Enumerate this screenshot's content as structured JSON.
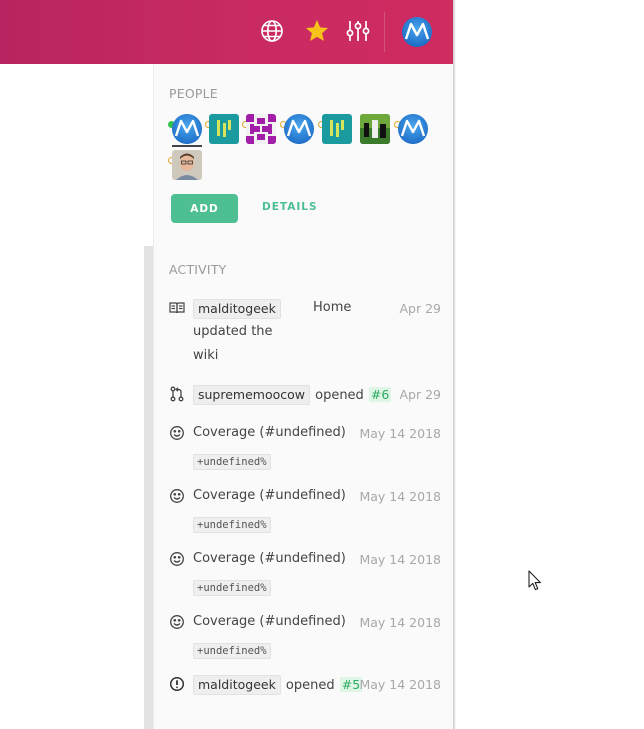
{
  "header": {
    "icons": [
      "globe-icon",
      "star-icon",
      "sliders-icon"
    ],
    "colors": {
      "bar": "#c92a62",
      "star": "#f7c31a"
    }
  },
  "people": {
    "title": "PEOPLE",
    "avatars": [
      "avatar-1",
      "avatar-2",
      "avatar-3",
      "avatar-4",
      "avatar-5",
      "avatar-6",
      "avatar-7",
      "avatar-8"
    ],
    "add_label": "ADD",
    "details_label": "DETAILS",
    "accent_color": "#4ebf93"
  },
  "activity": {
    "title": "ACTIVITY",
    "items": [
      {
        "icon": "book-icon",
        "user": "malditogeek",
        "action_line1": "updated the",
        "action_line2": "wiki",
        "target": "Home",
        "date": "Apr 29"
      },
      {
        "icon": "pull-request-icon",
        "user": "suprememoocow",
        "action": "opened",
        "link": "#6",
        "date": "Apr 29"
      },
      {
        "icon": "smiley-icon",
        "text": "Coverage (#undefined)",
        "code": "+undefined%",
        "date": "May 14 2018"
      },
      {
        "icon": "smiley-icon",
        "text": "Coverage (#undefined)",
        "code": "+undefined%",
        "date": "May 14 2018"
      },
      {
        "icon": "smiley-icon",
        "text": "Coverage (#undefined)",
        "code": "+undefined%",
        "date": "May 14 2018"
      },
      {
        "icon": "smiley-icon",
        "text": "Coverage (#undefined)",
        "code": "+undefined%",
        "date": "May 14 2018"
      },
      {
        "icon": "issue-icon",
        "user": "malditogeek",
        "action": "opened",
        "link": "#5",
        "date": "May 14 2018"
      }
    ]
  }
}
